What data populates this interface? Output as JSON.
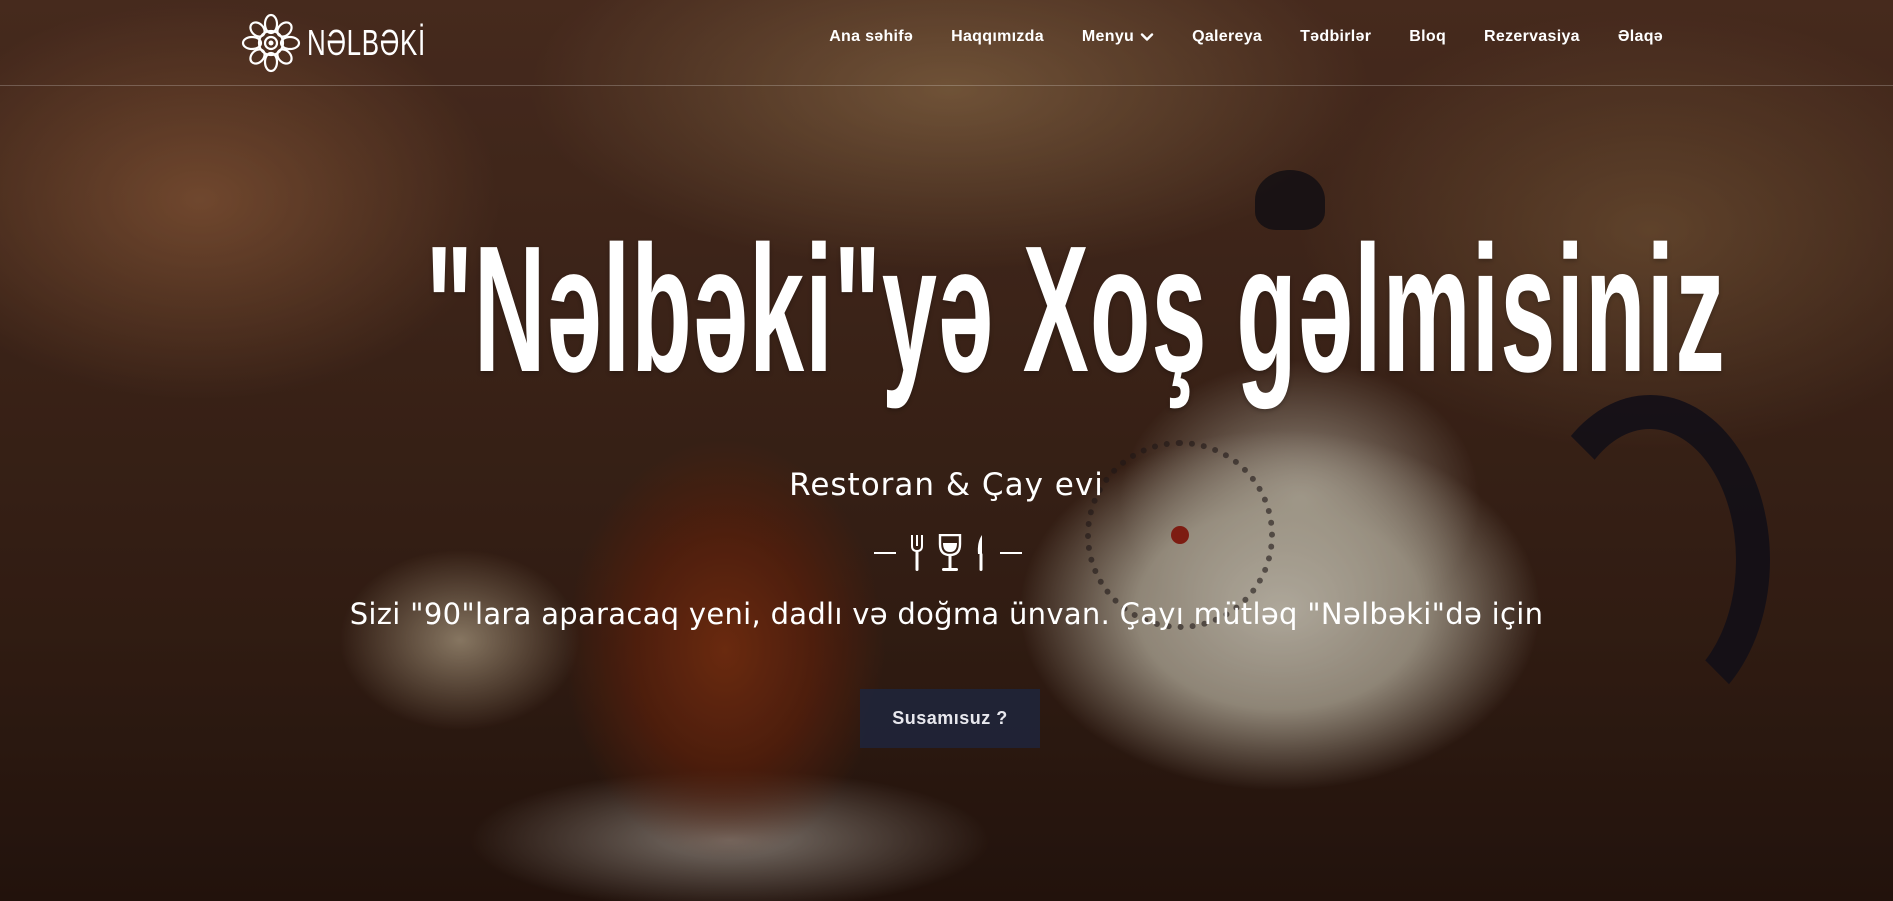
{
  "header": {
    "logo_text": "NƏLBƏKİ",
    "nav": [
      {
        "label": "Ana səhifə"
      },
      {
        "label": "Haqqımızda"
      },
      {
        "label": "Menyu",
        "has_dropdown": true
      },
      {
        "label": "Qalereya"
      },
      {
        "label": "Tədbirlər"
      },
      {
        "label": "Bloq"
      },
      {
        "label": "Rezervasiya"
      },
      {
        "label": "Əlaqə"
      }
    ]
  },
  "hero": {
    "title": "\"Nəlbəki\"yə Xoş gəlmisiniz",
    "subtitle": "Restoran & Çay evi",
    "divider_icons": [
      "fork-icon",
      "wine-glass-icon",
      "knife-icon"
    ],
    "tagline": "Sizi \"90\"lara aparacaq yeni, dadlı və doğma ünvan. Çayı mütləq \"Nəlbəki\"də için",
    "cta_label": "Susamısuz ?"
  },
  "colors": {
    "cta_bg": "#202438",
    "text": "#ffffff"
  }
}
